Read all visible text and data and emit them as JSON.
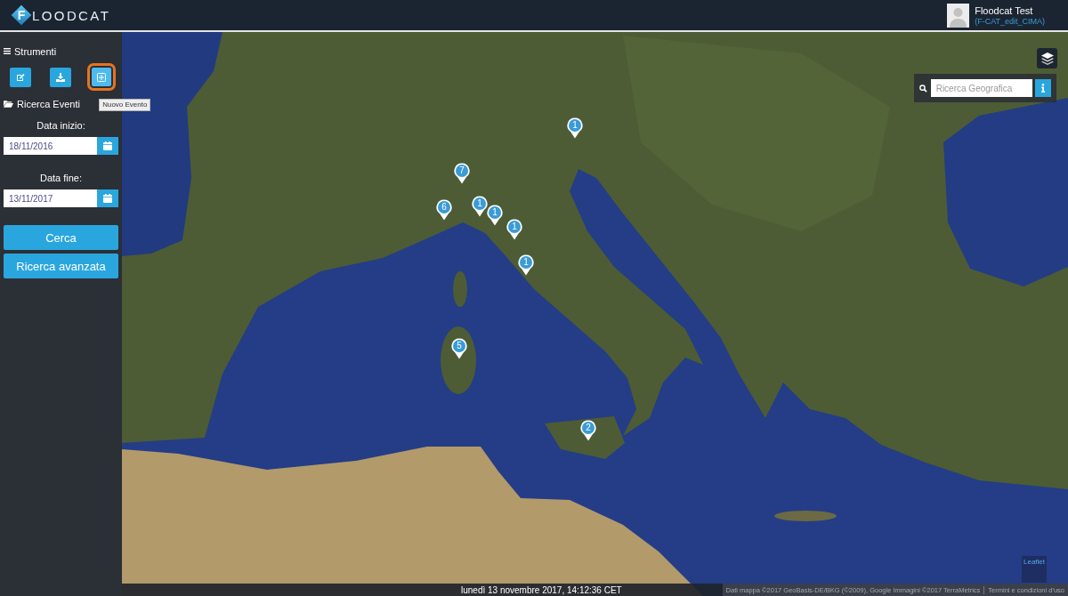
{
  "header": {
    "logo": {
      "initial": "F",
      "text": "LOODCAT"
    },
    "user": {
      "name": "Floodcat Test",
      "role": "(F-CAT_edit_CIMA)"
    }
  },
  "sidebar": {
    "tools": {
      "title": "Strumenti",
      "buttons": [
        {
          "kind": "edit",
          "focused": false
        },
        {
          "kind": "download",
          "focused": false
        },
        {
          "kind": "new",
          "focused": true,
          "tooltip": "Nuovo Evento"
        }
      ]
    },
    "search": {
      "title": "Ricerca Eventi",
      "fields": [
        {
          "label": "Data inizio:",
          "value": "18/11/2016"
        },
        {
          "label": "Data fine:",
          "value": "13/11/2017"
        }
      ],
      "buttons": [
        {
          "label": "Cerca"
        },
        {
          "label": "Ricerca avanzata"
        }
      ]
    }
  },
  "map": {
    "geo_search": {
      "placeholder": "Ricerca Geografica"
    },
    "clusters": [
      {
        "count": "1"
      },
      {
        "count": "7"
      },
      {
        "count": "1"
      },
      {
        "count": "6"
      },
      {
        "count": "1"
      },
      {
        "count": "1"
      },
      {
        "count": "1"
      },
      {
        "count": "5"
      },
      {
        "count": "2"
      }
    ],
    "attribution_link": "Leaflet"
  },
  "status_bar": {
    "datetime": "lunedì 13 novembre 2017, 14:12:36 CET",
    "map_data": "Dati mappa ©2017 GeoBasis-DE/BKG (©2009), Google Immagini ©2017 TerraMetrics",
    "terms_link": "Termini e condizioni d'uso"
  }
}
